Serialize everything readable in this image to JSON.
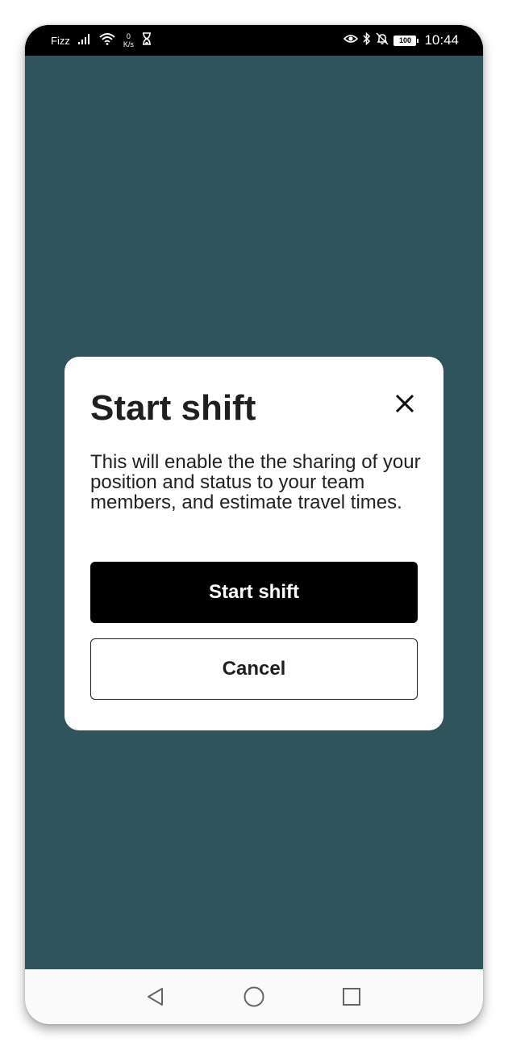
{
  "status_bar": {
    "carrier": "Fizz",
    "net_speed_value": "0",
    "net_speed_unit": "K/s",
    "battery": "100",
    "time": "10:44",
    "icons": [
      "signal-icon",
      "wifi-icon",
      "hourglass-icon",
      "eye-icon",
      "bluetooth-icon",
      "bell-off-icon",
      "battery-icon"
    ]
  },
  "dialog": {
    "title": "Start shift",
    "body": "This will enable the the sharing of your position and status to your team members, and estimate travel times.",
    "primary_label": "Start shift",
    "secondary_label": "Cancel",
    "close_icon": "close-icon"
  },
  "nav_bar": {
    "icons": [
      "back-icon",
      "home-icon",
      "recents-icon"
    ]
  },
  "colors": {
    "background": "#2f545b",
    "dialog": "#ffffff",
    "primary_button": "#000000",
    "status_bar": "#000000"
  }
}
